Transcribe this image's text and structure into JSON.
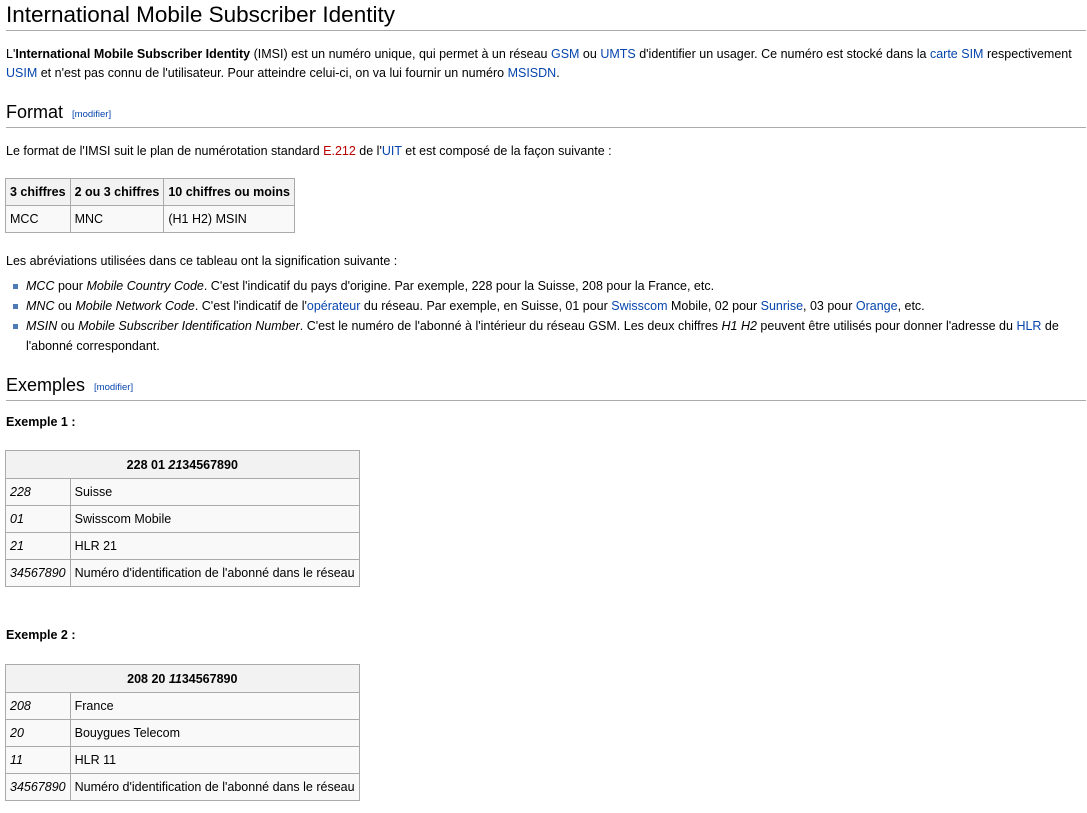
{
  "title": "International Mobile Subscriber Identity",
  "intro": {
    "t1": "L'",
    "bold": "International Mobile Subscriber Identity",
    "t2": " (IMSI) est un numéro unique, qui permet à un réseau ",
    "gsm": "GSM",
    "t3": " ou ",
    "umts": "UMTS",
    "t4": " d'identifier un usager. Ce numéro est stocké dans la ",
    "carte_sim": "carte SIM",
    "t5": " respectivement ",
    "usim": "USIM",
    "t6": " et n'est pas connu de l'utilisateur. Pour atteindre celui-ci, on va lui fournir un numéro ",
    "msisdn": "MSISDN",
    "t7": "."
  },
  "edit_label": "[modifier]",
  "format": {
    "heading": "Format",
    "p1_a": "Le format de l'IMSI suit le plan de numérotation standard ",
    "e212": "E.212",
    "p1_b": " de l'",
    "uit": "UIT",
    "p1_c": " et est composé de la façon suivante :",
    "table_headers": [
      "3 chiffres",
      "2 ou 3 chiffres",
      "10 chiffres ou moins"
    ],
    "table_row": [
      "MCC",
      "MNC",
      "(H1 H2) MSIN"
    ],
    "abbr_intro": "Les abréviations utilisées dans ce tableau ont la signification suivante :",
    "b1": {
      "i1": "MCC",
      "t1": " pour ",
      "i2": "Mobile Country Code",
      "t2": ". C'est l'indicatif du pays d'origine. Par exemple, 228 pour la Suisse, 208 pour la France, etc."
    },
    "b2": {
      "i1": "MNC",
      "t1": " ou ",
      "i2": "Mobile Network Code",
      "t2": ". C'est l'indicatif de l'",
      "operateur": "opérateur",
      "t3": " du réseau. Par exemple, en Suisse, 01 pour ",
      "swisscom": "Swisscom",
      "t4": " Mobile, 02 pour ",
      "sunrise": "Sunrise",
      "t5": ", 03 pour ",
      "orange": "Orange",
      "t6": ", etc."
    },
    "b3": {
      "i1": "MSIN",
      "t1": " ou ",
      "i2": "Mobile Subscriber Identification Number",
      "t2": ". C'est le numéro de l'abonné à l'intérieur du réseau GSM. Les deux chiffres ",
      "i3": "H1 H2",
      "t3": " peuvent être utilisés pour donner l'adresse du ",
      "hlr": "HLR",
      "t4": " de l'abonné correspondant."
    }
  },
  "examples": {
    "heading": "Exemples",
    "ex1": {
      "label": "Exemple 1 :",
      "header_a": "228 01 ",
      "header_i": "21",
      "header_b": "34567890",
      "rows": [
        [
          "228",
          "Suisse"
        ],
        [
          "01",
          "Swisscom Mobile"
        ],
        [
          "21",
          "HLR 21"
        ],
        [
          "34567890",
          "Numéro d'identification de l'abonné dans le réseau"
        ]
      ]
    },
    "ex2": {
      "label": "Exemple 2 :",
      "header_a": "208 20 ",
      "header_i": "11",
      "header_b": "34567890",
      "rows": [
        [
          "208",
          "France"
        ],
        [
          "20",
          "Bouygues Telecom"
        ],
        [
          "11",
          "HLR 11"
        ],
        [
          "34567890",
          "Numéro d'identification de l'abonné dans le réseau"
        ]
      ]
    }
  },
  "colors": {
    "link": "#0645ad",
    "redlink": "#ba0000",
    "border": "#aaaaaa",
    "bullet": "#4f7bb5"
  }
}
